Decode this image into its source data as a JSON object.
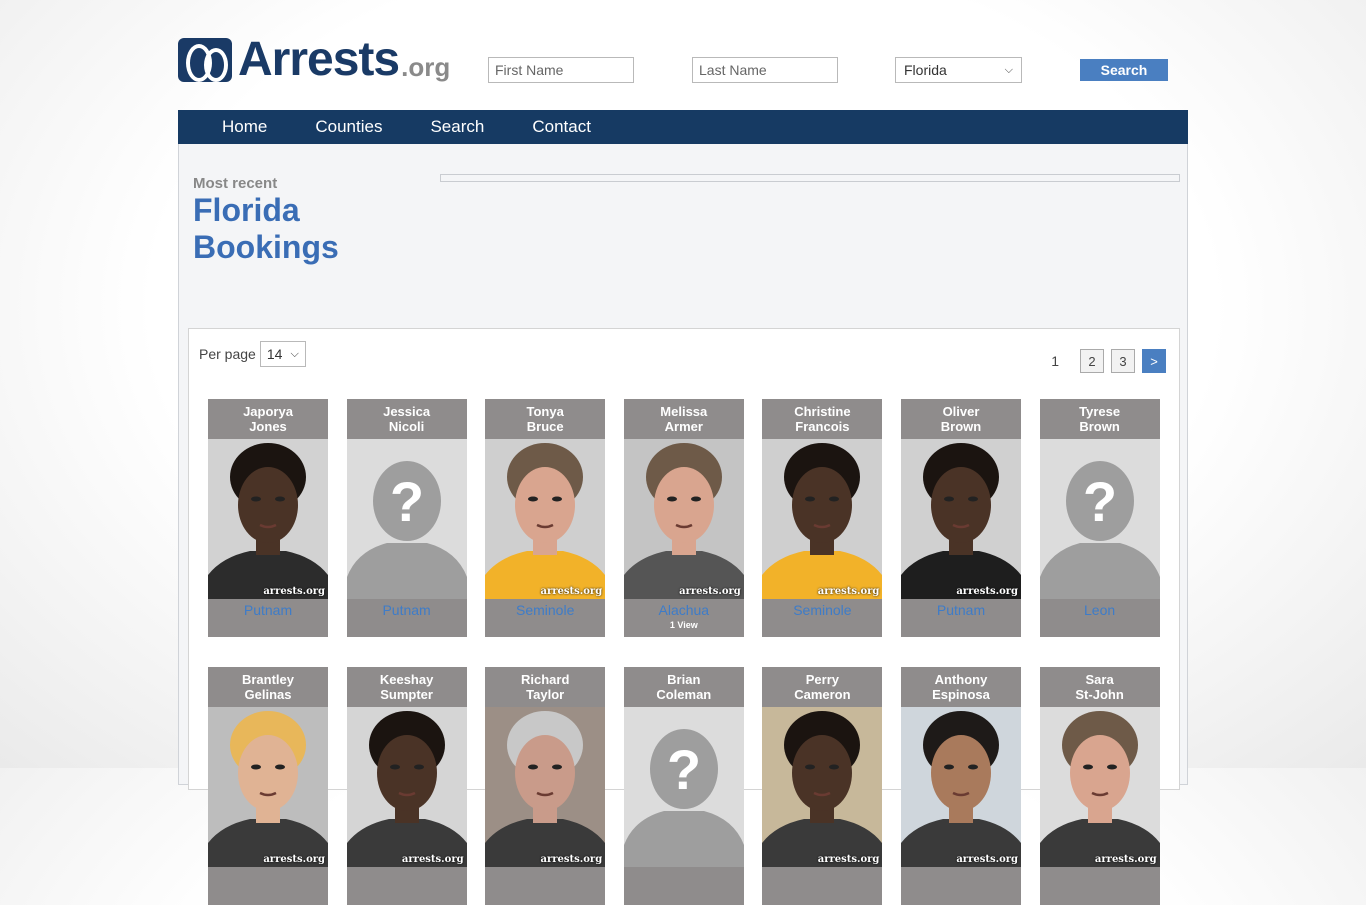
{
  "header": {
    "logo_text": "Arrests",
    "logo_suffix": ".org",
    "first_name_placeholder": "First Name",
    "last_name_placeholder": "Last Name",
    "state_value": "Florida",
    "search_label": "Search"
  },
  "nav": [
    "Home",
    "Counties",
    "Search",
    "Contact"
  ],
  "page": {
    "kicker": "Most recent",
    "title_line1": "Florida",
    "title_line2": "Bookings"
  },
  "list": {
    "per_page_label": "Per page",
    "per_page_value": "14",
    "pager": {
      "current": "1",
      "pages": [
        "2",
        "3"
      ],
      "next": ">"
    }
  },
  "watermark": "arrests.org",
  "bookings_row1": [
    {
      "first": "Japorya",
      "last": "Jones",
      "county": "Putnam",
      "views": "",
      "photo": "dark",
      "shirt": "#2c2c2c",
      "bg": "#d2d2d2"
    },
    {
      "first": "Jessica",
      "last": "Nicoli",
      "county": "Putnam",
      "views": "",
      "photo": "placeholder",
      "shirt": "",
      "bg": ""
    },
    {
      "first": "Tonya",
      "last": "Bruce",
      "county": "Seminole",
      "views": "",
      "photo": "light",
      "shirt": "#f2b229",
      "bg": "#cfcfcf"
    },
    {
      "first": "Melissa",
      "last": "Armer",
      "county": "Alachua",
      "views": "1 View",
      "photo": "light",
      "shirt": "#555555",
      "bg": "#c4c4c4"
    },
    {
      "first": "Christine",
      "last": "Francois",
      "county": "Seminole",
      "views": "",
      "photo": "dark",
      "shirt": "#f2b229",
      "bg": "#cfcfcf"
    },
    {
      "first": "Oliver",
      "last": "Brown",
      "county": "Putnam",
      "views": "",
      "photo": "dark",
      "shirt": "#1e1e1e",
      "bg": "#d0d0d0"
    },
    {
      "first": "Tyrese",
      "last": "Brown",
      "county": "Leon",
      "views": "",
      "photo": "placeholder",
      "shirt": "",
      "bg": ""
    }
  ],
  "bookings_row2": [
    {
      "first": "Brantley",
      "last": "Gelinas",
      "photo": "blond",
      "bg": "#bdbdbd"
    },
    {
      "first": "Keeshay",
      "last": "Sumpter",
      "photo": "dark",
      "bg": "#d5d5d5"
    },
    {
      "first": "Richard",
      "last": "Taylor",
      "photo": "gray",
      "bg": "#9c8f86"
    },
    {
      "first": "Brian",
      "last": "Coleman",
      "photo": "placeholder",
      "bg": ""
    },
    {
      "first": "Perry",
      "last": "Cameron",
      "photo": "dark",
      "bg": "#c7b89a"
    },
    {
      "first": "Anthony",
      "last": "Espinosa",
      "photo": "tan",
      "bg": "#cfd6dc"
    },
    {
      "first": "Sara",
      "last": "St-John",
      "photo": "light",
      "bg": "#dcdcdc"
    }
  ]
}
